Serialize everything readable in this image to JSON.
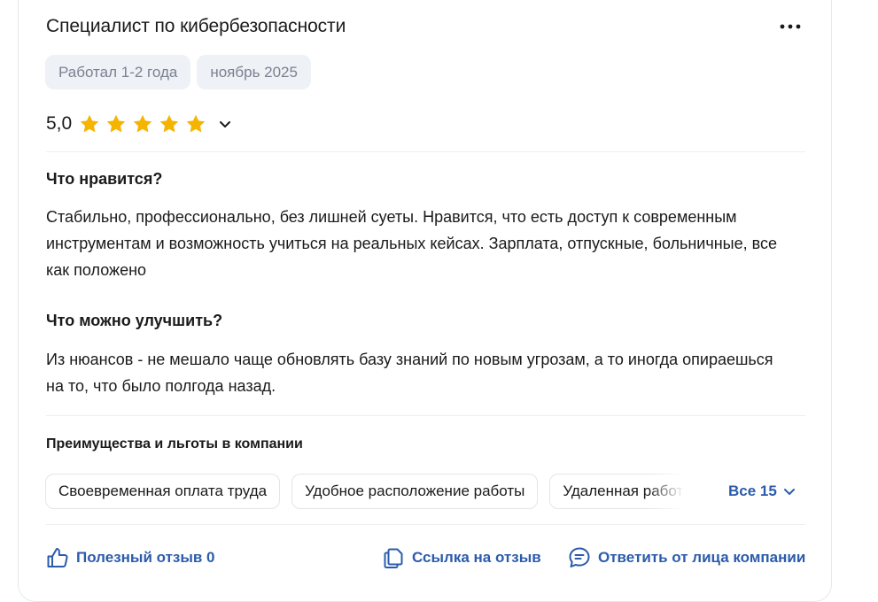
{
  "review": {
    "title": "Специалист по кибербезопасности",
    "tags": [
      "Работал 1-2 года",
      "ноябрь 2025"
    ],
    "rating": "5,0",
    "stars": 5,
    "likes_title": "Что нравится?",
    "likes_text": "Стабильно, профессионально, без лишней суеты. Нравится, что есть доступ к современным инструментам и возможность учиться на реальных кейсах. Зарплата, отпускные, больничные, все как положено",
    "improve_title": "Что можно улучшить?",
    "improve_text": "Из нюансов - не мешало чаще обновлять базу знаний по новым угрозам, а то иногда опираешься на то, что было полгода назад."
  },
  "benefits": {
    "title": "Преимущества и льготы в компании",
    "chips": [
      "Своевременная оплата труда",
      "Удобное расположение работы",
      "Удаленная работа"
    ],
    "all_label": "Все 15"
  },
  "actions": {
    "helpful": "Полезный отзыв 0",
    "link": "Ссылка на отзыв",
    "reply": "Ответить от лица компании"
  },
  "icons": {
    "more": "more-horizontal-icon",
    "star": "star-icon",
    "chevron": "chevron-down-icon",
    "thumbs_up": "thumbs-up-icon",
    "copy_link": "copy-icon",
    "chat": "chat-bubble-icon"
  },
  "colors": {
    "accent": "#2b5cab",
    "star": "#f5b400",
    "tag_bg": "#eef1f6",
    "tag_text": "#7a8290"
  }
}
